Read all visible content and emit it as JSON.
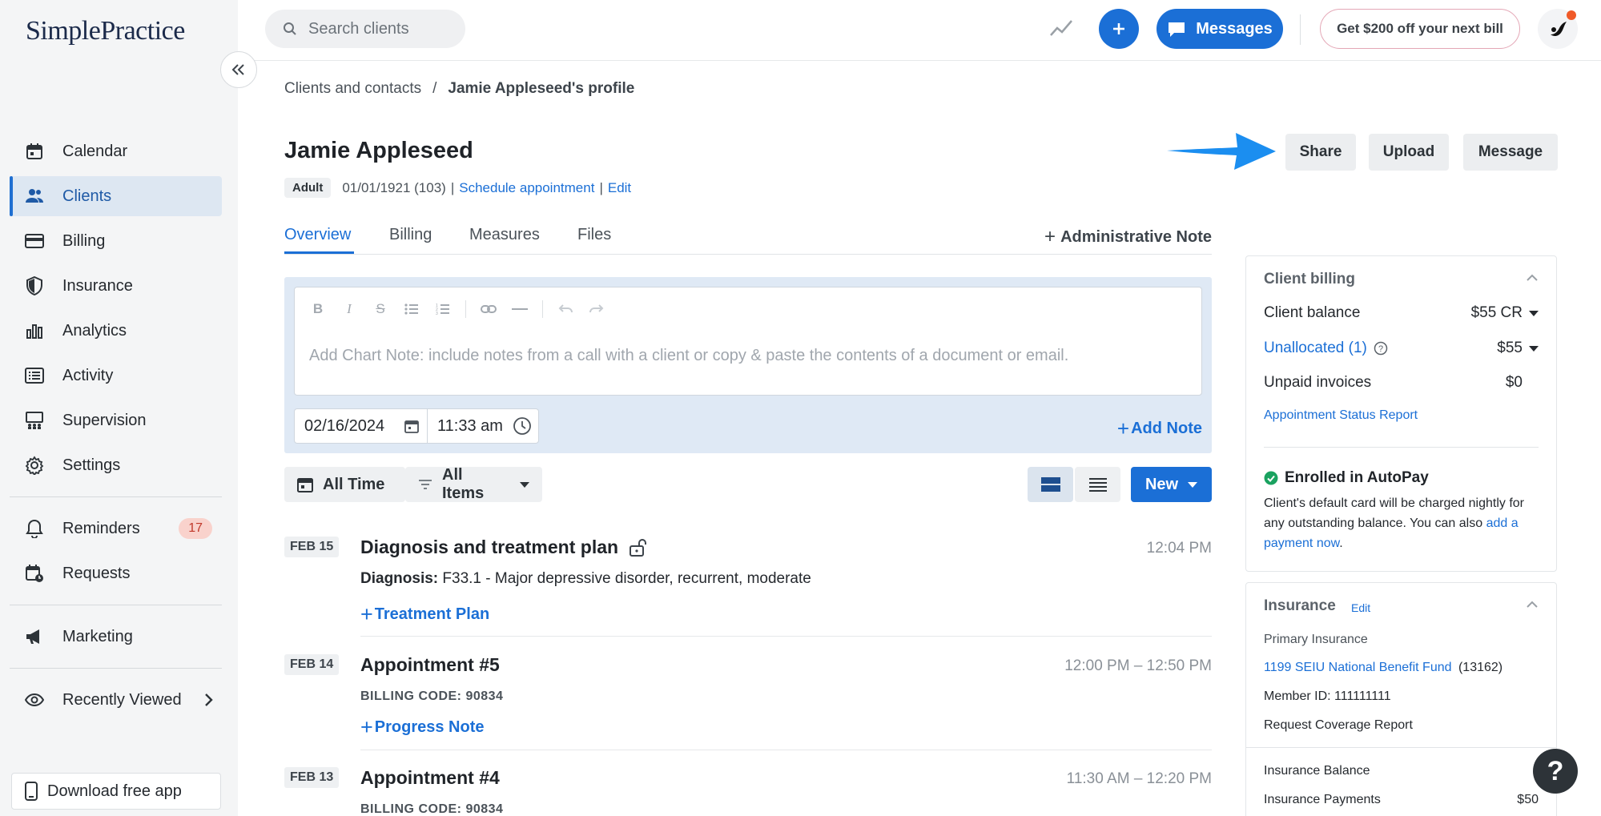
{
  "app": {
    "logo_text": "SimplePractice",
    "brand_color": "#1b6fd6"
  },
  "sidebar": {
    "items": [
      {
        "label": "Calendar",
        "icon": "calendar-icon"
      },
      {
        "label": "Clients",
        "icon": "clients-icon",
        "active": true
      },
      {
        "label": "Billing",
        "icon": "billing-card-icon"
      },
      {
        "label": "Insurance",
        "icon": "shield-icon"
      },
      {
        "label": "Analytics",
        "icon": "bar-chart-icon"
      },
      {
        "label": "Activity",
        "icon": "activity-list-icon"
      },
      {
        "label": "Supervision",
        "icon": "supervision-icon"
      },
      {
        "label": "Settings",
        "icon": "gear-icon"
      }
    ],
    "reminders": {
      "label": "Reminders",
      "count": "17"
    },
    "requests": {
      "label": "Requests"
    },
    "marketing": {
      "label": "Marketing"
    },
    "recently_viewed": {
      "label": "Recently Viewed"
    },
    "download_app": "Download free app"
  },
  "topbar": {
    "search_placeholder": "Search clients",
    "messages_label": "Messages",
    "promo_label": "Get $200 off your next bill"
  },
  "breadcrumb": {
    "parent": "Clients and contacts",
    "separator": "/",
    "current": "Jamie Appleseed's profile"
  },
  "client": {
    "name": "Jamie Appleseed",
    "type_pill": "Adult",
    "dob_age": "01/01/1921 (103)",
    "pipe": "|",
    "schedule_link": "Schedule appointment",
    "edit_link": "Edit"
  },
  "header_actions": {
    "share": "Share",
    "upload": "Upload",
    "message": "Message"
  },
  "tabs": {
    "overview": "Overview",
    "billing": "Billing",
    "measures": "Measures",
    "files": "Files",
    "admin_note": "Administrative Note"
  },
  "note_editor": {
    "placeholder": "Add Chart Note: include notes from a call with a client or copy & paste the contents of a document or email.",
    "date": "02/16/2024",
    "time": "11:33 am",
    "add_note": "Add Note"
  },
  "filters": {
    "all_time": "All Time",
    "all_items": "All Items",
    "new": "New"
  },
  "timeline": [
    {
      "date": "FEB 15",
      "title": "Diagnosis and treatment plan",
      "time": "12:04 PM",
      "diagnosis_label": "Diagnosis:",
      "diagnosis_value": "F33.1 - Major depressive disorder, recurrent, moderate",
      "link": "Treatment Plan"
    },
    {
      "date": "FEB 14",
      "title": "Appointment #5",
      "time": "12:00 PM – 12:50 PM",
      "billing_code": "BILLING CODE: 90834",
      "link": "Progress Note"
    },
    {
      "date": "FEB 13",
      "title": "Appointment #4",
      "time": "11:30 AM – 12:20 PM",
      "billing_code": "BILLING CODE: 90834"
    }
  ],
  "client_billing": {
    "title": "Client billing",
    "balance_label": "Client balance",
    "balance_value": "$55 CR",
    "unallocated_label": "Unallocated (1)",
    "unallocated_value": "$55",
    "unpaid_label": "Unpaid invoices",
    "unpaid_value": "$0",
    "status_report_link": "Appointment Status Report",
    "autopay_title": "Enrolled in AutoPay",
    "autopay_text": "Client's default card will be charged nightly for any outstanding balance. You can also",
    "autopay_link": "add a payment now",
    "autopay_period": "."
  },
  "insurance": {
    "title": "Insurance",
    "edit": "Edit",
    "primary_label": "Primary Insurance",
    "payer_link": "1199 SEIU National Benefit Fund",
    "payer_id": "(13162)",
    "member_id": "Member ID: 111111111",
    "coverage_link": "Request Coverage Report",
    "balance_label": "Insurance Balance",
    "payments_label": "Insurance Payments",
    "payments_value": "$50"
  },
  "help_fab": "?"
}
